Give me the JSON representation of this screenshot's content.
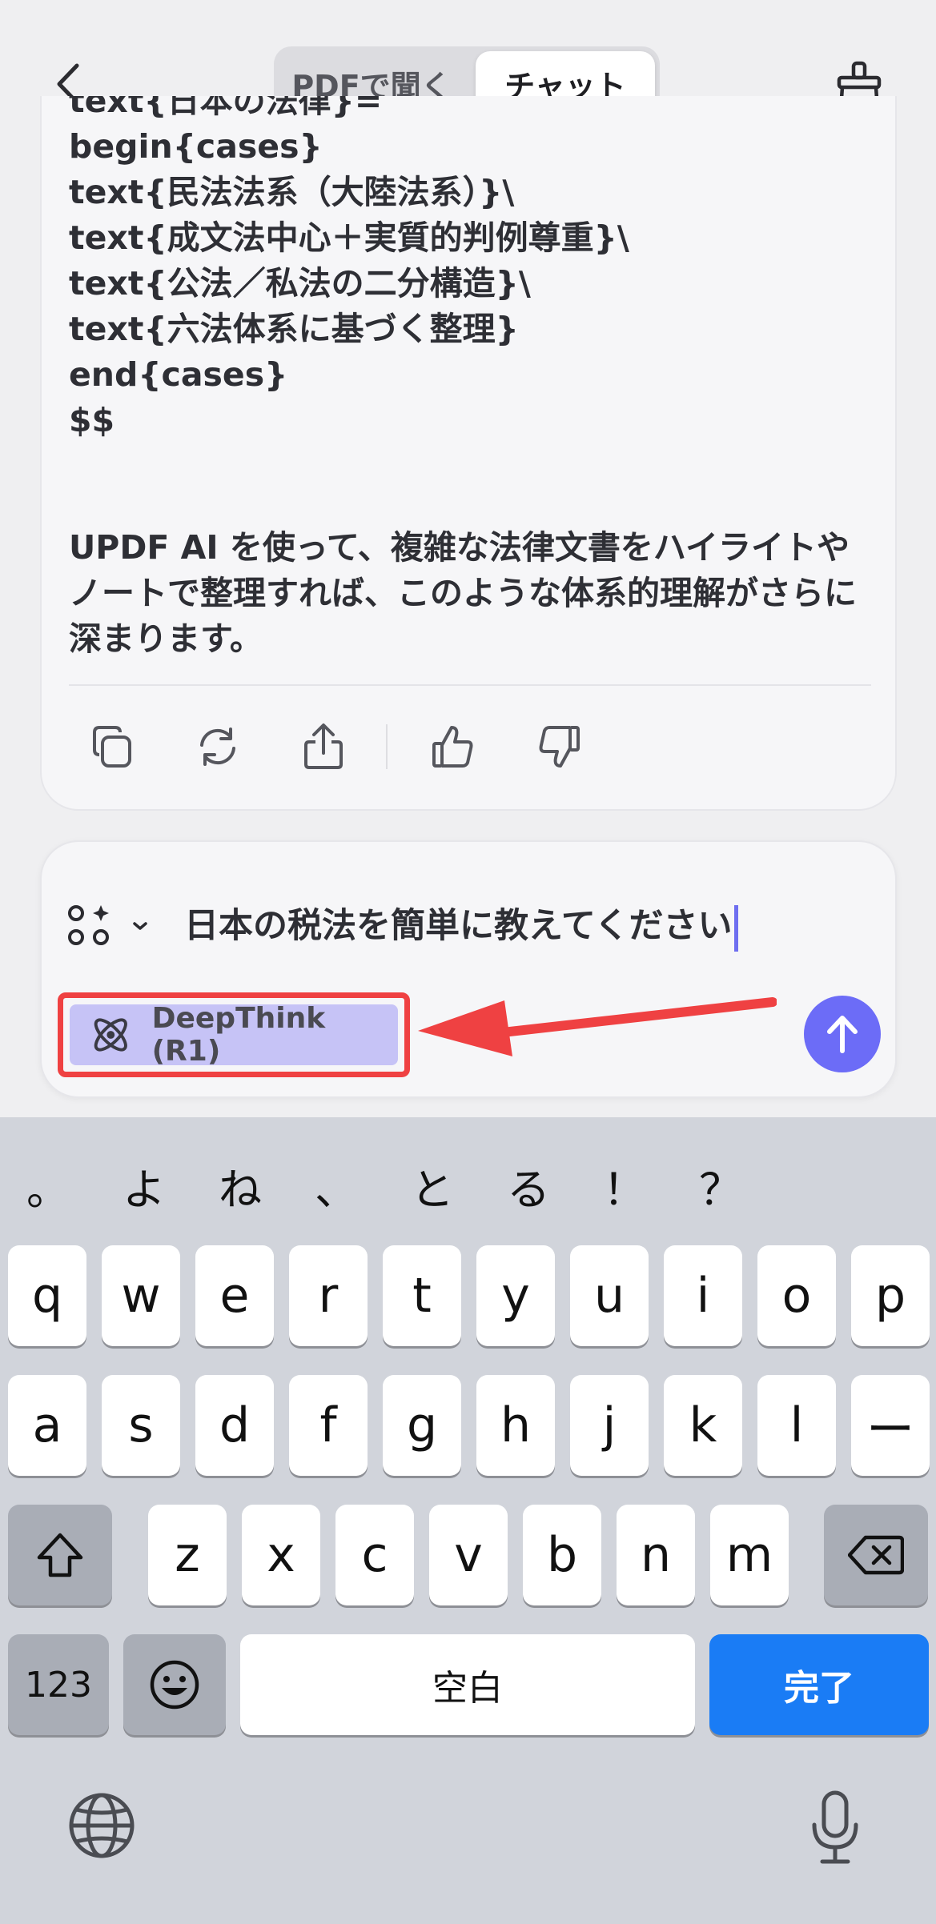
{
  "header": {
    "back_icon": "chevron-left-icon",
    "tab_listen": "PDFで聞く",
    "tab_chat": "チャット",
    "clear_icon": "broom-icon"
  },
  "message": {
    "lines": [
      "text{日本の法律}=",
      "begin{cases}",
      "text{民法法系（大陸法系）}\\",
      "text{成文法中心＋実質的判例尊重}\\",
      "text{公法／私法の二分構造}\\",
      "text{六法体系に基づく整理}",
      "end{cases}",
      "$$"
    ],
    "paragraph": "UPDF AI を使って、複雑な法律文書をハイライトやノートで整理すれば、このような体系的理解がさらに深まります。",
    "actions": [
      "copy-icon",
      "regenerate-icon",
      "share-icon",
      "thumbs-up-icon",
      "thumbs-down-icon"
    ]
  },
  "input": {
    "model_icon": "apps-sparkle-icon",
    "value": "日本の税法を簡単に教えてください",
    "deepthink_label": "DeepThink (R1)",
    "deepthink_icon": "atom-icon",
    "send_icon": "arrow-up-icon"
  },
  "keyboard": {
    "candidates": [
      "。",
      "よ",
      "ね",
      "、",
      "と",
      "る",
      "！",
      "？"
    ],
    "row1": [
      "q",
      "w",
      "e",
      "r",
      "t",
      "y",
      "u",
      "i",
      "o",
      "p"
    ],
    "row2": [
      "a",
      "s",
      "d",
      "f",
      "g",
      "h",
      "j",
      "k",
      "l",
      "ー"
    ],
    "row3": [
      "z",
      "x",
      "c",
      "v",
      "b",
      "n",
      "m"
    ],
    "numbers_key": "123",
    "space_key": "空白",
    "done_key": "完了"
  },
  "colors": {
    "accent": "#6c6cf7",
    "deepthink_bg": "#c6c3f6",
    "annotation": "#ef4142",
    "done_key": "#1a7cf5"
  }
}
